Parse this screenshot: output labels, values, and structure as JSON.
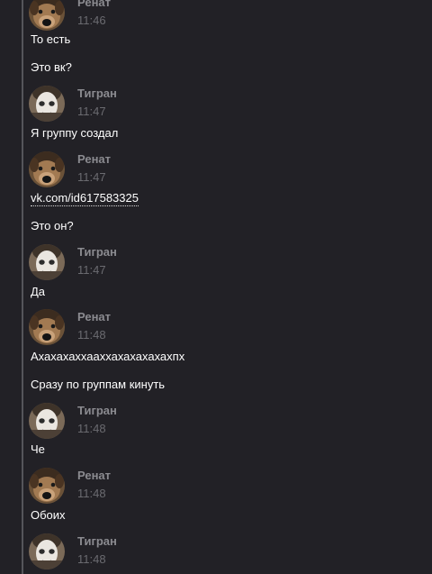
{
  "colors": {
    "background": "#222126",
    "thread_line": "#55555a",
    "author": "#8b8b90",
    "time": "#6b6b70",
    "text": "#ffffff"
  },
  "icons": {
    "avatar_renat": "dog-avatar-photo",
    "avatar_tigran": "white-face-avatar-photo"
  },
  "messages": {
    "m0": {
      "author": "Ренат",
      "time": "11:46"
    },
    "m0_text_1": "То есть",
    "m0_text_2": "Это вк?",
    "m1": {
      "author": "Тигран",
      "time": "11:47"
    },
    "m1_text_1": "Я группу создал",
    "m2": {
      "author": "Ренат",
      "time": "11:47"
    },
    "m2_link": "vk.com/id617583325",
    "m2_text_2": "Это он?",
    "m3": {
      "author": "Тигран",
      "time": "11:47"
    },
    "m3_text_1": "Да",
    "m4": {
      "author": "Ренат",
      "time": "11:48"
    },
    "m4_text_1": "Ахахахаххааххахахахахахпх",
    "m4_text_2": "Сразу по группам кинуть",
    "m5": {
      "author": "Тигран",
      "time": "11:48"
    },
    "m5_text_1": "Че",
    "m6": {
      "author": "Ренат",
      "time": "11:48"
    },
    "m6_text_1": "Обоих",
    "m7": {
      "author": "Тигран",
      "time": "11:48"
    }
  }
}
